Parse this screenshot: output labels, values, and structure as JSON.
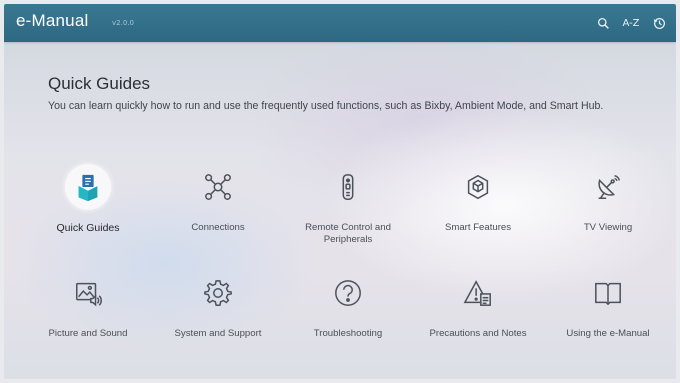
{
  "header": {
    "title": "e-Manual",
    "version": "v2.0.0",
    "icons": [
      "search-icon",
      "a-z-index-icon",
      "recent-history-icon"
    ],
    "az_label": "A-Z"
  },
  "main": {
    "title": "Quick Guides",
    "description": "You can learn quickly how to run and use the frequently used functions, such as Bixby, Ambient Mode, and Smart Hub."
  },
  "categories": [
    {
      "label": "Quick Guides",
      "icon": "quick-guides-icon",
      "selected": true
    },
    {
      "label": "Connections",
      "icon": "connections-icon"
    },
    {
      "label": "Remote Control and Peripherals",
      "icon": "remote-control-icon"
    },
    {
      "label": "Smart Features",
      "icon": "smart-features-icon"
    },
    {
      "label": "TV Viewing",
      "icon": "satellite-dish-icon"
    },
    {
      "label": "Picture and Sound",
      "icon": "picture-sound-icon"
    },
    {
      "label": "System and Support",
      "icon": "gear-icon"
    },
    {
      "label": "Troubleshooting",
      "icon": "question-icon"
    },
    {
      "label": "Precautions and Notes",
      "icon": "warning-icon"
    },
    {
      "label": "Using the e-Manual",
      "icon": "book-icon"
    }
  ],
  "colors": {
    "header_bg": "#2d6882",
    "selected_icon_teal": "#1ea2b4",
    "selected_icon_blue": "#2a6fb0",
    "icon_stroke": "#4c525a"
  }
}
